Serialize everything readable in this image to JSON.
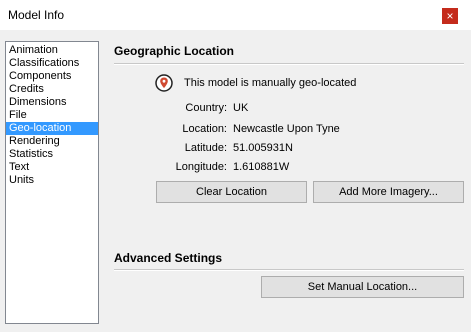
{
  "window": {
    "title": "Model Info",
    "close_glyph": "×"
  },
  "sidebar": {
    "items": [
      {
        "label": "Animation"
      },
      {
        "label": "Classifications"
      },
      {
        "label": "Components"
      },
      {
        "label": "Credits"
      },
      {
        "label": "Dimensions"
      },
      {
        "label": "File"
      },
      {
        "label": "Geo-location",
        "selected": true
      },
      {
        "label": "Rendering"
      },
      {
        "label": "Statistics"
      },
      {
        "label": "Text"
      },
      {
        "label": "Units"
      }
    ]
  },
  "geo": {
    "section_title": "Geographic Location",
    "status_icon": "map-pin-icon",
    "status_text": "This model is manually geo-located",
    "country_label": "Country:",
    "country_value": "UK",
    "location_label": "Location:",
    "location_value": "Newcastle Upon Tyne",
    "latitude_label": "Latitude:",
    "latitude_value": "51.005931N",
    "longitude_label": "Longitude:",
    "longitude_value": "1.610881W",
    "clear_button": "Clear Location",
    "add_imagery_button": "Add More Imagery..."
  },
  "advanced": {
    "section_title": "Advanced Settings",
    "set_manual_button": "Set Manual Location..."
  },
  "colors": {
    "selection": "#3399ff",
    "close": "#c42b1c",
    "pin": "#d04a32"
  }
}
